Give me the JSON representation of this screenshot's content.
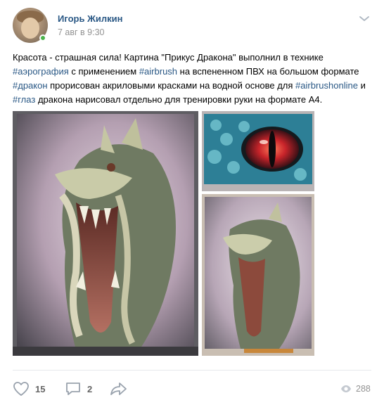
{
  "post": {
    "author": "Игорь Жилкин",
    "time": "7 авг в 9:30",
    "text_segments": [
      {
        "text": "Красота - страшная сила! Картина \"Прикус Дракона\" выполнил в технике ",
        "tag": false
      },
      {
        "text": "#аэрография",
        "tag": true
      },
      {
        "text": " с применением ",
        "tag": false
      },
      {
        "text": "#airbrush",
        "tag": true
      },
      {
        "text": " на вспененном ПВХ на большом формате ",
        "tag": false
      },
      {
        "text": "#дракон",
        "tag": true
      },
      {
        "text": " прорисован акриловыми красками на водной основе для ",
        "tag": false
      },
      {
        "text": "#airbrushonline",
        "tag": true
      },
      {
        "text": " и ",
        "tag": false
      },
      {
        "text": "#глаз",
        "tag": true
      },
      {
        "text": " дракона нарисовал отдельно для тренировки руки на формате А4.",
        "tag": false
      }
    ]
  },
  "actions": {
    "likes": "15",
    "comments": "2",
    "views": "288"
  },
  "colors": {
    "link": "#2a5885",
    "muted": "#939393",
    "online": "#4bb34b",
    "action_text": "#656565"
  },
  "icons": [
    "chevron-down-icon",
    "heart-icon",
    "comment-icon",
    "share-icon",
    "eye-icon"
  ]
}
